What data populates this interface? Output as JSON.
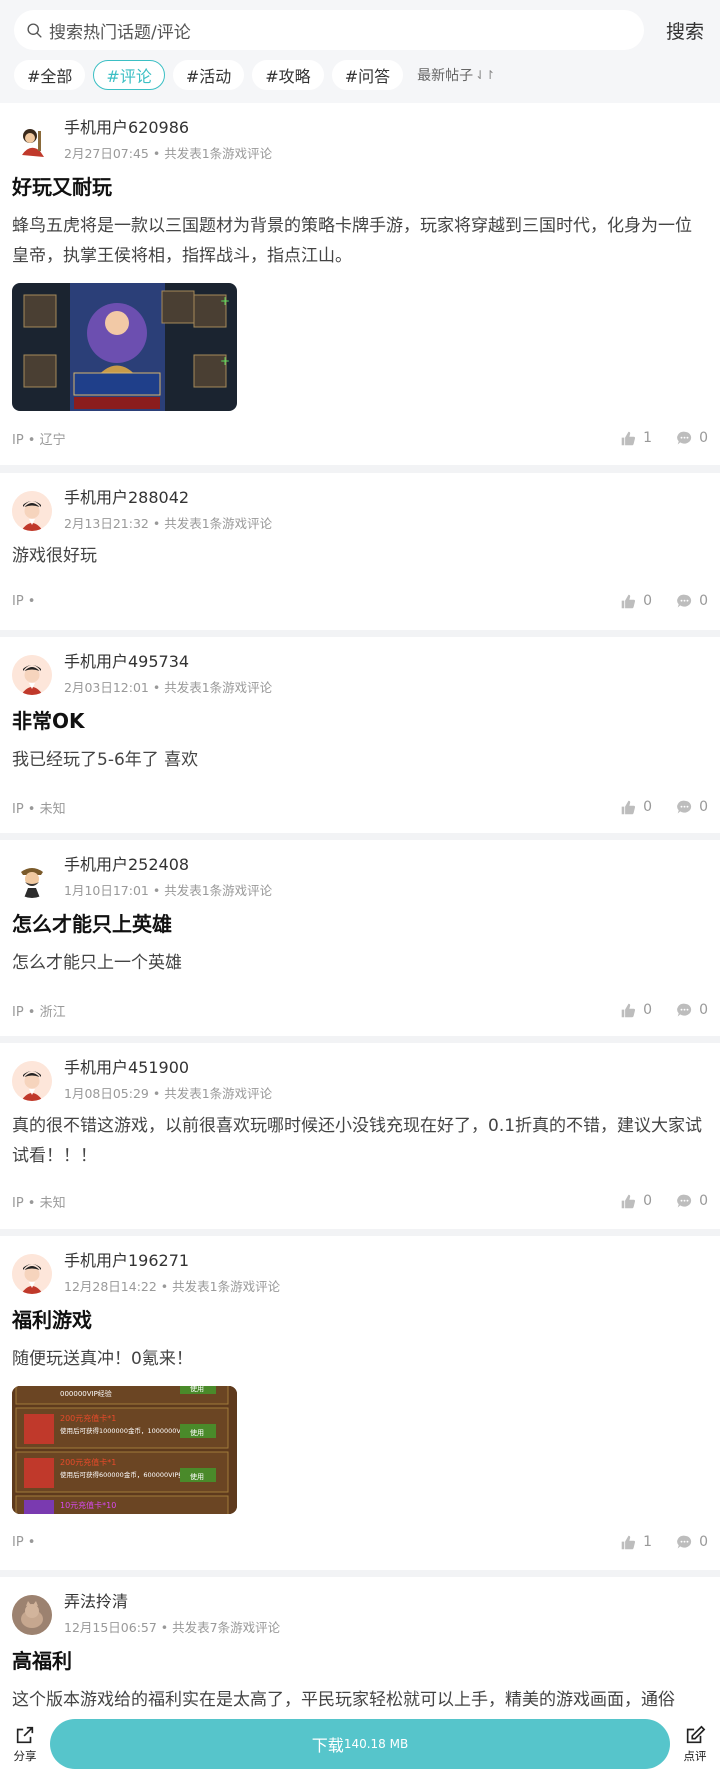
{
  "search": {
    "placeholder": "搜索热门话题/评论",
    "button": "搜索"
  },
  "tabs": [
    {
      "label": "#全部"
    },
    {
      "label": "#评论"
    },
    {
      "label": "#活动"
    },
    {
      "label": "#攻略"
    },
    {
      "label": "#问答"
    }
  ],
  "sort_label": "最新帖子",
  "sort_icon": "⇃↾",
  "posts": [
    {
      "user": "手机用户620986",
      "meta": "2月27日07:45 • 共发表1条游戏评论",
      "title": "好玩又耐玩",
      "body": "蜂鸟五虎将是一款以三国题材为背景的策略卡牌手游，玩家将穿越到三国时代，化身为一位皇帝，执掌王侯将相，指挥战斗，指点江山。",
      "ip": "IP • 辽宁",
      "likes": "1",
      "comments": "0"
    },
    {
      "user": "手机用户288042",
      "meta": "2月13日21:32 • 共发表1条游戏评论",
      "title": "",
      "body": "游戏很好玩",
      "ip": "IP •",
      "likes": "0",
      "comments": "0"
    },
    {
      "user": "手机用户495734",
      "meta": "2月03日12:01 • 共发表1条游戏评论",
      "title": "非常OK",
      "body": "我已经玩了5-6年了 喜欢",
      "ip": "IP • 未知",
      "likes": "0",
      "comments": "0"
    },
    {
      "user": "手机用户252408",
      "meta": "1月10日17:01 • 共发表1条游戏评论",
      "title": "怎么才能只上英雄",
      "body": "怎么才能只上一个英雄",
      "ip": "IP • 浙江",
      "likes": "0",
      "comments": "0"
    },
    {
      "user": "手机用户451900",
      "meta": "1月08日05:29 • 共发表1条游戏评论",
      "title": "",
      "body": "真的很不错这游戏，以前很喜欢玩哪时候还小没钱充现在好了，0.1折真的不错，建议大家试试看！！！",
      "ip": "IP • 未知",
      "likes": "0",
      "comments": "0"
    },
    {
      "user": "手机用户196271",
      "meta": "12月28日14:22 • 共发表1条游戏评论",
      "title": "福利游戏",
      "body": "随便玩送真冲！0氪来！",
      "ip": "IP •",
      "likes": "1",
      "comments": "0"
    },
    {
      "user": "弄法拎清",
      "meta": "12月15日06:57 • 共发表7条游戏评论",
      "title": "高福利",
      "body": "这个版本游戏给的福利实在是太高了，平民玩家轻松就可以上手，精美的游戏画面，通俗",
      "ip": "",
      "likes": "",
      "comments": ""
    }
  ],
  "image2": {
    "rows": [
      {
        "title": "000000VIP经验",
        "desc": "",
        "btn": "使用"
      },
      {
        "title": "200元充值卡*1",
        "desc": "使用后可获得1000000金币，1000000VIP经验",
        "btn": "使用"
      },
      {
        "title": "200元充值卡*1",
        "desc": "使用后可获得600000金币，600000VIP经验",
        "btn": "使用"
      },
      {
        "title": "10元充值卡*10",
        "desc": "",
        "btn": ""
      }
    ]
  },
  "bottom": {
    "share": "分享",
    "download": "下载",
    "size": "140.18 MB",
    "review": "点评"
  },
  "colors": {
    "accent": "#3bbfc4",
    "download_bg": "#56c5cb"
  }
}
